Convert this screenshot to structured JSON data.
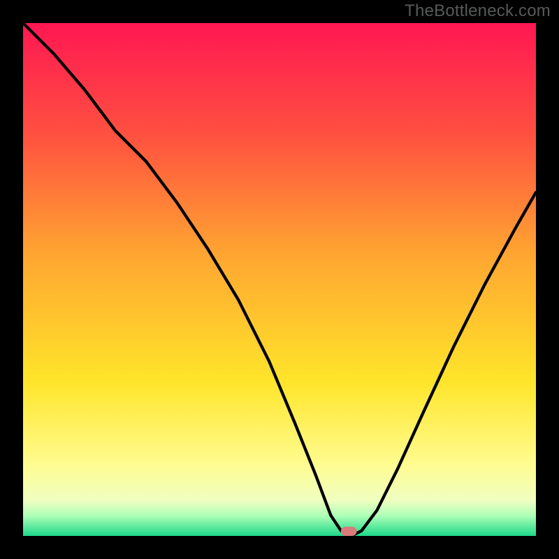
{
  "watermark": "TheBottleneck.com",
  "chart_data": {
    "type": "line",
    "title": "",
    "xlabel": "",
    "ylabel": "",
    "xlim": [
      0,
      100
    ],
    "ylim": [
      0,
      100
    ],
    "grid": false,
    "legend": false,
    "x": [
      0,
      6,
      12,
      18,
      24,
      30,
      36,
      42,
      48,
      53,
      57,
      60,
      62,
      64,
      66,
      69,
      73,
      78,
      84,
      90,
      96,
      100
    ],
    "values": [
      100,
      94,
      87,
      79,
      73,
      65,
      56,
      46,
      34,
      22,
      12,
      4,
      1,
      0,
      1,
      5,
      13,
      24,
      37,
      49,
      60,
      67
    ],
    "marker": {
      "x": 63.5,
      "y": 0,
      "w": 3.1,
      "h": 1.8
    },
    "background_gradient_stops": [
      {
        "pos": 0.0,
        "color": "#ff1752"
      },
      {
        "pos": 0.22,
        "color": "#ff5140"
      },
      {
        "pos": 0.45,
        "color": "#ffa531"
      },
      {
        "pos": 0.7,
        "color": "#ffe52a"
      },
      {
        "pos": 0.86,
        "color": "#fffc90"
      },
      {
        "pos": 0.93,
        "color": "#f0ffc0"
      },
      {
        "pos": 0.96,
        "color": "#b0ffb8"
      },
      {
        "pos": 1.0,
        "color": "#1cd989"
      }
    ]
  }
}
